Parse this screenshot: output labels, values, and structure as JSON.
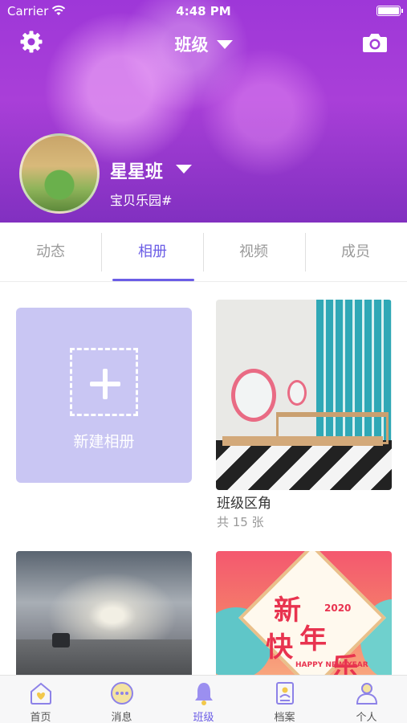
{
  "status_bar": {
    "carrier": "Carrier",
    "time": "4:48 PM"
  },
  "header": {
    "title": "班级",
    "class_name": "星星班",
    "school_name": "宝贝乐园#",
    "icons": {
      "settings": "gear-icon",
      "camera": "camera-icon"
    }
  },
  "tabs": [
    {
      "label": "动态",
      "active": false
    },
    {
      "label": "相册",
      "active": true
    },
    {
      "label": "视频",
      "active": false
    },
    {
      "label": "成员",
      "active": false
    }
  ],
  "albums": {
    "new_album_label": "新建相册",
    "items": [
      {
        "title": "班级区角",
        "count": "共 15 张"
      }
    ],
    "cover3_text": {
      "c1": "新",
      "c2": "快",
      "c3": "年",
      "c4": "乐",
      "year": "2020",
      "sub": "HAPPY\nNEW YEAR"
    }
  },
  "tab_bar": [
    {
      "label": "首页",
      "icon": "home-icon",
      "active": false
    },
    {
      "label": "消息",
      "icon": "message-icon",
      "active": false
    },
    {
      "label": "班级",
      "icon": "bell-icon",
      "active": true
    },
    {
      "label": "档案",
      "icon": "archive-icon",
      "active": false
    },
    {
      "label": "个人",
      "icon": "person-icon",
      "active": false
    }
  ],
  "colors": {
    "accent": "#6b5de6",
    "header_purple": "#9e37d8",
    "new_album_bg": "#c9c6f3"
  }
}
